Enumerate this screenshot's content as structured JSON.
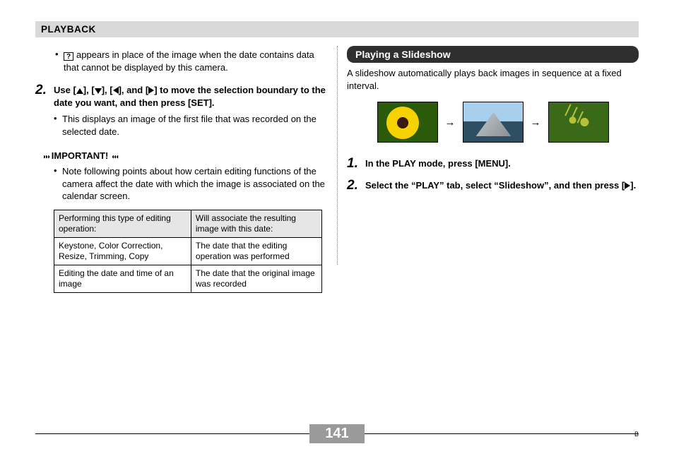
{
  "header": {
    "section": "PLAYBACK"
  },
  "left": {
    "note1": "appears in place of the image when the date contains data that cannot be displayed by this camera.",
    "question_icon_label": "?",
    "step2": {
      "num": "2.",
      "pre": "Use [",
      "mid1": "], [",
      "mid2": "], [",
      "mid3": "], and [",
      "post": "] to move the selection boundary to the date you want, and then press [SET]."
    },
    "step2_sub": "This displays an image of the first file that was recorded on the selected date.",
    "important_label": "IMPORTANT!",
    "important_note": "Note following points about how certain editing functions of the camera affect the date with which the image is associated on the calendar screen.",
    "table": {
      "h1": "Performing this type of editing operation:",
      "h2": "Will associate the resulting image with this date:",
      "r1c1": "Keystone, Color Correction, Resize, Trimming, Copy",
      "r1c2": "The date that the editing operation was performed",
      "r2c1": "Editing the date and time of an image",
      "r2c2": "The date that the original image was recorded"
    }
  },
  "right": {
    "section_title": "Playing a Slideshow",
    "desc": "A slideshow automatically plays back images in sequence at a fixed interval.",
    "step1": {
      "num": "1.",
      "text": "In the PLAY mode, press [MENU]."
    },
    "step2": {
      "num": "2.",
      "pre": "Select the “PLAY” tab, select “Slideshow”, and then press [",
      "post": "]."
    }
  },
  "footer": {
    "page": "141",
    "b": "B"
  }
}
